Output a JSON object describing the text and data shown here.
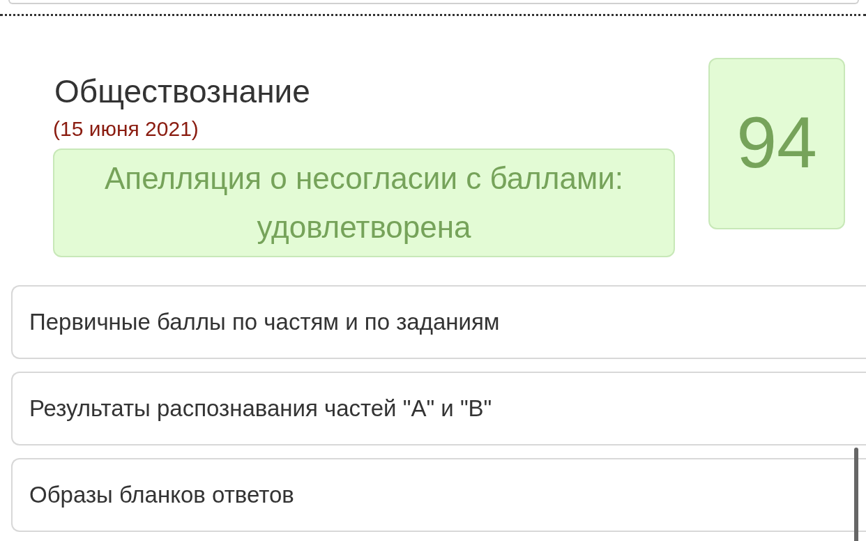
{
  "exam": {
    "subject": "Обществознание",
    "date": "(15 июня 2021)",
    "appeal": "Апелляция о несогласии с баллами: удовлетворена",
    "score": "94"
  },
  "sections": [
    {
      "label": "Первичные баллы по частям и по заданиям"
    },
    {
      "label": "Результаты распознавания частей \"A\" и \"B\""
    },
    {
      "label": "Образы бланков ответов"
    }
  ]
}
